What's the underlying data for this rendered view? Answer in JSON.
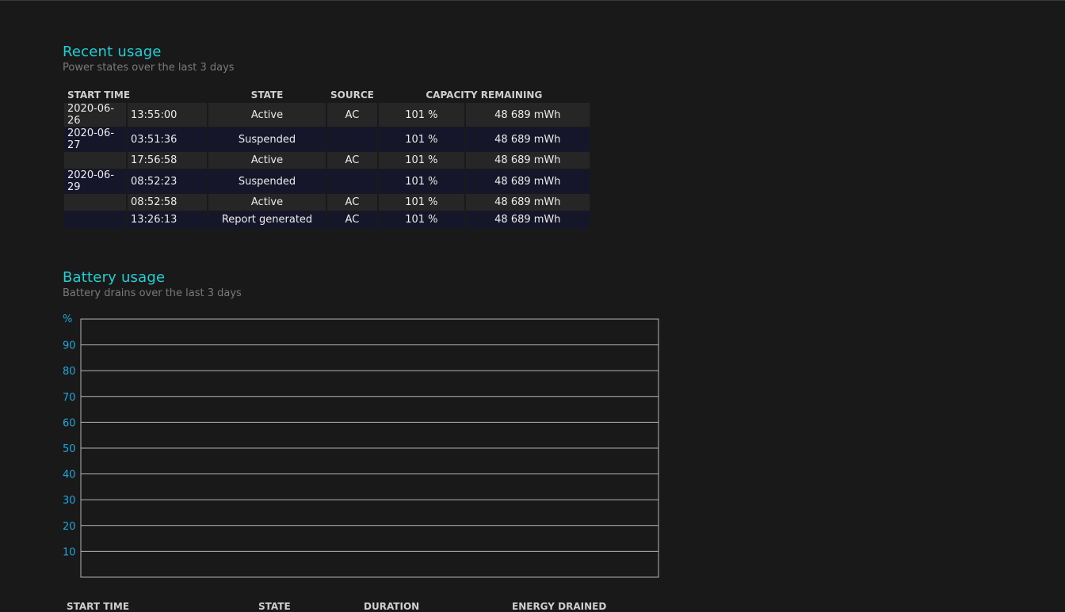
{
  "recent": {
    "title": "Recent usage",
    "subtitle": "Power states over the last 3 days",
    "headers": [
      "START TIME",
      "STATE",
      "SOURCE",
      "CAPACITY REMAINING"
    ],
    "rows": [
      {
        "date": "2020-06-26",
        "time": "13:55:00",
        "state": "Active",
        "source": "AC",
        "percent": "101 %",
        "capacity": "48 689 mWh"
      },
      {
        "date": "2020-06-27",
        "time": "03:51:36",
        "state": "Suspended",
        "source": "",
        "percent": "101 %",
        "capacity": "48 689 mWh"
      },
      {
        "date": "",
        "time": "17:56:58",
        "state": "Active",
        "source": "AC",
        "percent": "101 %",
        "capacity": "48 689 mWh"
      },
      {
        "date": "2020-06-29",
        "time": "08:52:23",
        "state": "Suspended",
        "source": "",
        "percent": "101 %",
        "capacity": "48 689 mWh"
      },
      {
        "date": "",
        "time": "08:52:58",
        "state": "Active",
        "source": "AC",
        "percent": "101 %",
        "capacity": "48 689 mWh"
      },
      {
        "date": "",
        "time": "13:26:13",
        "state": "Report generated",
        "source": "AC",
        "percent": "101 %",
        "capacity": "48 689 mWh"
      }
    ]
  },
  "battery": {
    "title": "Battery usage",
    "subtitle": "Battery drains over the last 3 days",
    "bottom_headers": [
      "START TIME",
      "STATE",
      "DURATION",
      "ENERGY DRAINED"
    ]
  },
  "chart_data": {
    "type": "line",
    "ylabel": "%",
    "ylim": [
      0,
      100
    ],
    "yticks": [
      10,
      20,
      30,
      40,
      50,
      60,
      70,
      80,
      90
    ],
    "grid": true,
    "series": [],
    "colors": {
      "axis_labels": "#1aa7e0",
      "gridlines": "#b4b4b4"
    }
  },
  "colors": {
    "background": "#191919",
    "heading": "#1ed1d6",
    "row_odd": "#262626",
    "row_even": "#16162b"
  }
}
